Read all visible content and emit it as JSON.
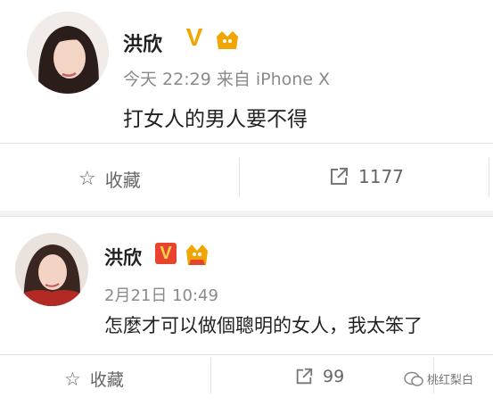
{
  "post1": {
    "author": "洪欣",
    "meta": "今天 22:29 来自 iPhone X",
    "text": "打女人的男人要不得",
    "favorite_label": "收藏",
    "share_count": "1177"
  },
  "post2": {
    "author": "洪欣",
    "meta": "2月21日 10:49",
    "text": "怎麼才可以做個聰明的女人，我太笨了",
    "favorite_label": "收藏",
    "share_count": "99"
  },
  "watermark": "桃红梨白",
  "colors": {
    "vip_badge": "#f0a500",
    "vip_badge_red": "#e8432f",
    "divider": "#e2e2e2",
    "section_bg": "#f3f3f3"
  }
}
